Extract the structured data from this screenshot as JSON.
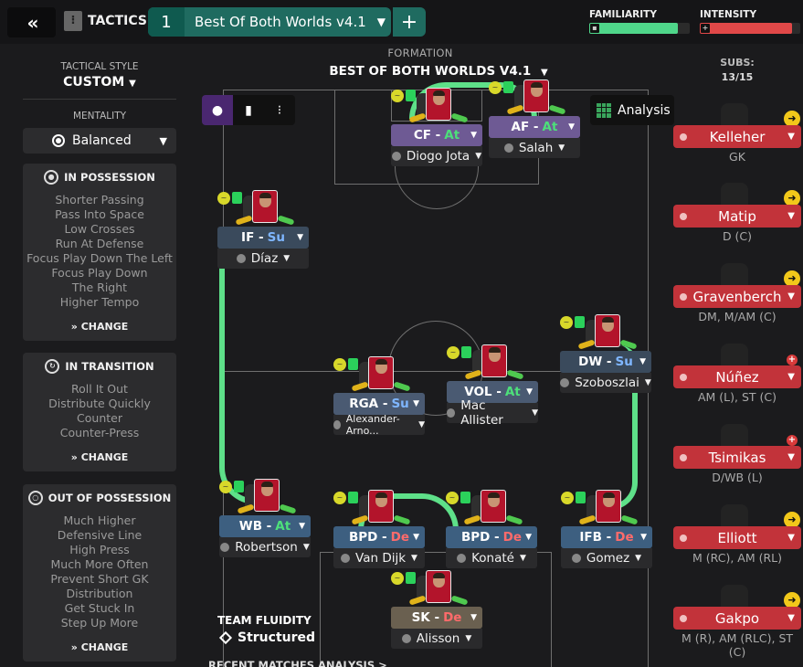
{
  "topbar": {
    "back_glyph": "«",
    "tactics_label": "TACTICS",
    "tactic_slot": "1",
    "tactic_name": "Best Of Both Worlds v4.1",
    "add_glyph": "+",
    "familiarity_label": "FAMILIARITY",
    "familiarity_level": 0.88,
    "familiarity_color": "#4fd68a",
    "intensity_label": "INTENSITY",
    "intensity_level": 0.92,
    "intensity_color": "#e04848"
  },
  "left": {
    "tactical_style_label": "TACTICAL STYLE",
    "tactical_style_value": "CUSTOM",
    "mentality_label": "MENTALITY",
    "mentality_value": "Balanced",
    "in_possession": {
      "title": "IN POSSESSION",
      "items": [
        "Shorter Passing",
        "Pass Into Space",
        "Low Crosses",
        "Run At Defense",
        "Focus Play Down The Left",
        "Focus Play Down The Right",
        "Higher Tempo"
      ],
      "change": "CHANGE"
    },
    "in_transition": {
      "title": "IN TRANSITION",
      "items": [
        "Roll It Out",
        "Distribute Quickly",
        "Counter",
        "Counter-Press"
      ],
      "change": "CHANGE"
    },
    "out_of_possession": {
      "title": "OUT OF POSSESSION",
      "items": [
        "Much Higher Defensive Line",
        "High Press",
        "Much More Often",
        "Prevent Short GK Distribution",
        "Get Stuck In",
        "Step Up More"
      ],
      "change": "CHANGE"
    }
  },
  "pitch": {
    "formation_label": "FORMATION",
    "formation_name": "BEST OF BOTH WORLDS V4.1",
    "analysis_label": "Analysis",
    "fluidity_label": "TEAM FLUIDITY",
    "fluidity_value": "Structured",
    "recent_label": "RECENT MATCHES ANALYSIS >",
    "players": [
      {
        "role": "CF",
        "duty": "At",
        "name": "Diogo Jota",
        "role_color": "#6e5a94",
        "duty_color": "#4de07a"
      },
      {
        "role": "AF",
        "duty": "At",
        "name": "Salah",
        "role_color": "#6e5a94",
        "duty_color": "#4de07a"
      },
      {
        "role": "IF",
        "duty": "Su",
        "name": "Díaz",
        "role_color": "#3a4a5c",
        "duty_color": "#7fb6ff"
      },
      {
        "role": "DW",
        "duty": "Su",
        "name": "Szoboszlai",
        "role_color": "#3a4a5c",
        "duty_color": "#7fb6ff"
      },
      {
        "role": "RGA",
        "duty": "Su",
        "name": "Alexander-Arno...",
        "role_color": "#4a5a72",
        "duty_color": "#7fb6ff"
      },
      {
        "role": "VOL",
        "duty": "At",
        "name": "Mac Allister",
        "role_color": "#4a5a72",
        "duty_color": "#4de07a"
      },
      {
        "role": "WB",
        "duty": "At",
        "name": "Robertson",
        "role_color": "#3d5f80",
        "duty_color": "#4de07a"
      },
      {
        "role": "BPD",
        "duty": "De",
        "name": "Van Dijk",
        "role_color": "#3d5f80",
        "duty_color": "#ff6b6b"
      },
      {
        "role": "BPD",
        "duty": "De",
        "name": "Konaté",
        "role_color": "#3d5f80",
        "duty_color": "#ff6b6b"
      },
      {
        "role": "IFB",
        "duty": "De",
        "name": "Gomez",
        "role_color": "#3d5f80",
        "duty_color": "#ff6b6b"
      },
      {
        "role": "SK",
        "duty": "De",
        "name": "Alisson",
        "role_color": "#6a6050",
        "duty_color": "#ff6b6b"
      }
    ]
  },
  "subs": {
    "title": "SUBS:",
    "count": "13/15",
    "list": [
      {
        "name": "Kelleher",
        "pos": "GK",
        "badge": "arrow"
      },
      {
        "name": "Matip",
        "pos": "D (C)",
        "badge": "arrow"
      },
      {
        "name": "Gravenberch",
        "pos": "DM, M/AM (C)",
        "badge": "arrow"
      },
      {
        "name": "Núñez",
        "pos": "AM (L), ST (C)",
        "badge": "plus"
      },
      {
        "name": "Tsimikas",
        "pos": "D/WB (L)",
        "badge": "plus"
      },
      {
        "name": "Elliott",
        "pos": "M (RC), AM (RL)",
        "badge": "arrow"
      },
      {
        "name": "Gakpo",
        "pos": "M (R), AM (RLC), ST (C)",
        "badge": "arrow"
      }
    ]
  }
}
